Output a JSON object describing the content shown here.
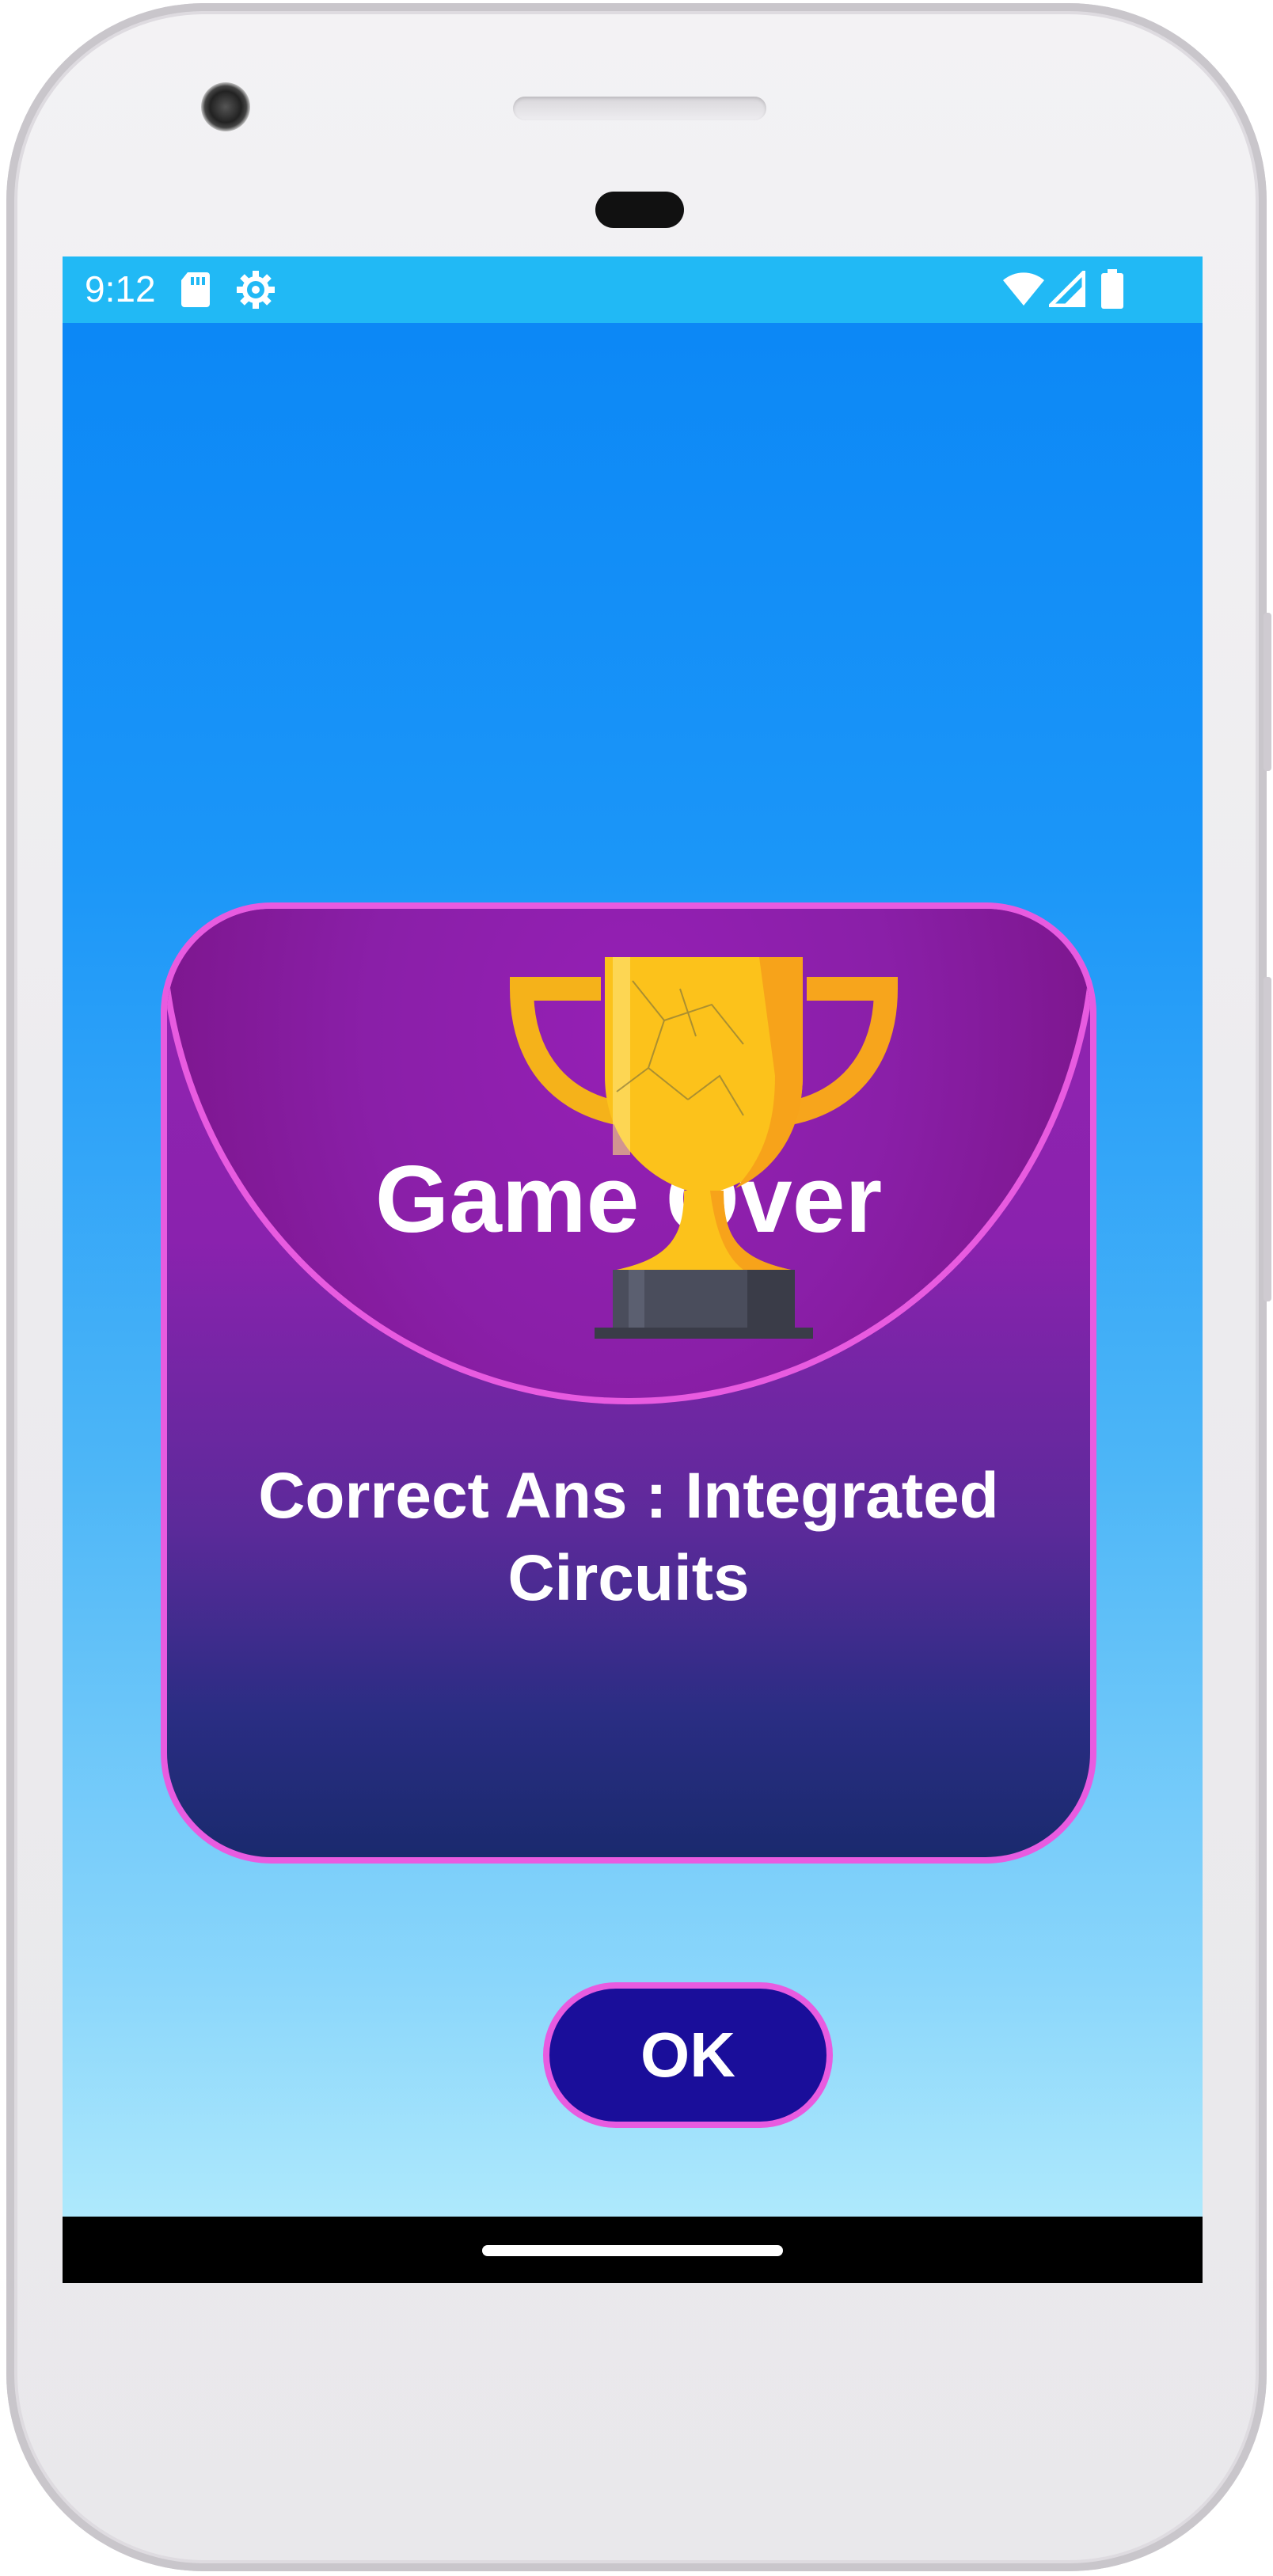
{
  "status_bar": {
    "time": "9:12",
    "icons": [
      "sd-card-icon",
      "settings-gear-icon",
      "wifi-icon",
      "cell-signal-icon",
      "battery-icon"
    ]
  },
  "dialog": {
    "title": "Game Over",
    "message": "Correct Ans : Integrated Circuits",
    "ok_label": "OK",
    "icon": "trophy-icon"
  },
  "colors": {
    "status_bar": "#21b9f5",
    "background_top": "#0a86f6",
    "background_bottom": "#b8eefc",
    "dialog_border": "#e85be0",
    "dialog_top": "#9224b0",
    "dialog_bottom": "#1a2a6e",
    "ok_button": "#1a0e9a",
    "trophy_gold": "#f7b81c",
    "trophy_base": "#4a4d5c"
  }
}
